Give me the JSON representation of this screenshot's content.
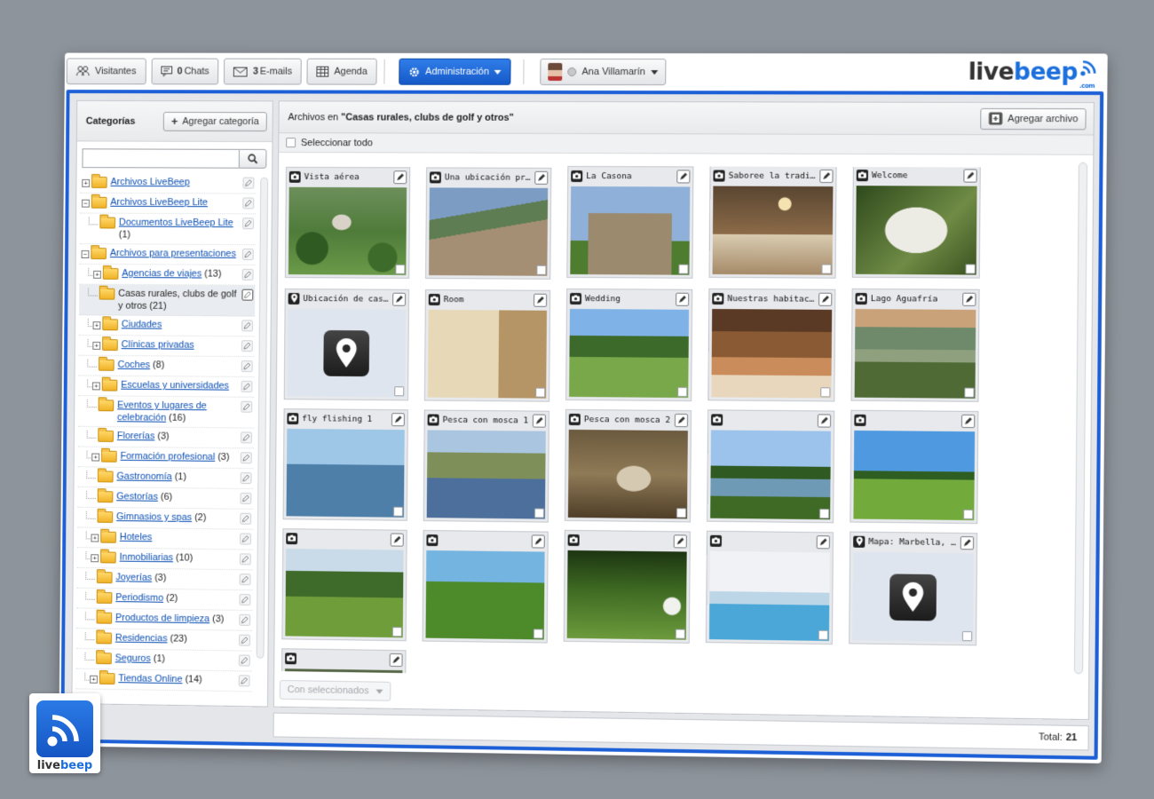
{
  "topbar": {
    "visitors": "Visitantes",
    "chats_count": "0",
    "chats_label": "Chats",
    "emails_count": "3",
    "emails_label": "E-mails",
    "agenda": "Agenda",
    "admin": "Administración",
    "user_name": "Ana Villamarín"
  },
  "logo": {
    "live": "live",
    "beep": "beep",
    "com": ".com"
  },
  "sidebar": {
    "title": "Categorías",
    "add_category": "Agregar categoría",
    "search_placeholder": "",
    "tree": [
      {
        "label": "Archivos LiveBeep",
        "count": "",
        "expander": "+",
        "level": 0,
        "link": true
      },
      {
        "label": "Archivos LiveBeep Lite",
        "count": "",
        "expander": "−",
        "level": 0,
        "link": true
      },
      {
        "label": "Documentos LiveBeep Lite",
        "count": "(1)",
        "expander": "",
        "level": 1,
        "link": true
      },
      {
        "label": "Archivos para presentaciones",
        "count": "",
        "expander": "−",
        "level": 0,
        "link": true
      },
      {
        "label": "Agencias de viajes",
        "count": "(13)",
        "expander": "+",
        "level": 1,
        "link": true
      },
      {
        "label": "Casas rurales, clubs de golf y otros",
        "count": "(21)",
        "expander": "",
        "level": 1,
        "link": false,
        "selected": true
      },
      {
        "label": "Ciudades",
        "count": "",
        "expander": "+",
        "level": 1,
        "link": true
      },
      {
        "label": "Clínicas privadas",
        "count": "",
        "expander": "+",
        "level": 1,
        "link": true
      },
      {
        "label": "Coches",
        "count": "(8)",
        "expander": "",
        "level": 1,
        "link": true
      },
      {
        "label": "Escuelas y universidades",
        "count": "",
        "expander": "+",
        "level": 1,
        "link": true
      },
      {
        "label": "Eventos y lugares de celebración",
        "count": "(16)",
        "expander": "",
        "level": 1,
        "link": true
      },
      {
        "label": "Florerías",
        "count": "(3)",
        "expander": "",
        "level": 1,
        "link": true
      },
      {
        "label": "Formación profesional",
        "count": "(3)",
        "expander": "+",
        "level": 1,
        "link": true
      },
      {
        "label": "Gastronomía",
        "count": "(1)",
        "expander": "",
        "level": 1,
        "link": true
      },
      {
        "label": "Gestorías",
        "count": "(6)",
        "expander": "",
        "level": 1,
        "link": true
      },
      {
        "label": "Gimnasios y spas",
        "count": "(2)",
        "expander": "",
        "level": 1,
        "link": true
      },
      {
        "label": "Hoteles",
        "count": "",
        "expander": "+",
        "level": 1,
        "link": true
      },
      {
        "label": "Inmobiliarias",
        "count": "(10)",
        "expander": "+",
        "level": 1,
        "link": true
      },
      {
        "label": "Joyerías",
        "count": "(3)",
        "expander": "",
        "level": 1,
        "link": true
      },
      {
        "label": "Periodismo",
        "count": "(2)",
        "expander": "",
        "level": 1,
        "link": true
      },
      {
        "label": "Productos de limpieza",
        "count": "(3)",
        "expander": "",
        "level": 1,
        "link": true
      },
      {
        "label": "Residencias",
        "count": "(23)",
        "expander": "",
        "level": 1,
        "link": true
      },
      {
        "label": "Seguros",
        "count": "(1)",
        "expander": "",
        "level": 1,
        "link": true
      },
      {
        "label": "Tiendas Online",
        "count": "(14)",
        "expander": "+",
        "level": 1,
        "link": true
      }
    ]
  },
  "main": {
    "title_prefix": "Archivos en ",
    "title_category": "\"Casas rurales, clubs de golf y otros\"",
    "add_file": "Agregar archivo",
    "select_all": "Seleccionar todo",
    "with_selected": "Con seleccionados",
    "total_label": "Total:",
    "total_value": "21",
    "files": [
      {
        "title": "Vista aérea",
        "type": "photo",
        "scene": "aerial"
      },
      {
        "title": "Una ubicación privilegiada",
        "type": "photo",
        "scene": "terrace"
      },
      {
        "title": "La Casona",
        "type": "photo",
        "scene": "manor"
      },
      {
        "title": "Saboree la tradición",
        "type": "photo",
        "scene": "dining"
      },
      {
        "title": "Welcome",
        "type": "photo",
        "scene": "welcome"
      },
      {
        "title": "Ubicación de casa rural",
        "type": "map",
        "scene": "map"
      },
      {
        "title": "Room",
        "type": "photo",
        "scene": "room"
      },
      {
        "title": "Wedding",
        "type": "photo",
        "scene": "wedding"
      },
      {
        "title": "Nuestras habitaciones",
        "type": "photo",
        "scene": "bedroom"
      },
      {
        "title": "Lago Aguafría",
        "type": "photo",
        "scene": "lake"
      },
      {
        "title": "fly flishing 1",
        "type": "photo",
        "scene": "fisher"
      },
      {
        "title": "Pesca con mosca 1",
        "type": "photo",
        "scene": "river"
      },
      {
        "title": "Pesca con mosca 2",
        "type": "photo",
        "scene": "fish"
      },
      {
        "title": "",
        "type": "photo",
        "scene": "pond"
      },
      {
        "title": "",
        "type": "photo",
        "scene": "golfclub"
      },
      {
        "title": "",
        "type": "photo",
        "scene": "fairway"
      },
      {
        "title": "",
        "type": "photo",
        "scene": "golfer"
      },
      {
        "title": "",
        "type": "photo",
        "scene": "ball"
      },
      {
        "title": "",
        "type": "photo",
        "scene": "pool"
      },
      {
        "title": "Mapa: Marbella, España",
        "type": "map",
        "scene": "map"
      },
      {
        "title": "",
        "type": "photo",
        "scene": "partial"
      }
    ]
  },
  "badge": {
    "live": "live",
    "beep": "beep"
  }
}
